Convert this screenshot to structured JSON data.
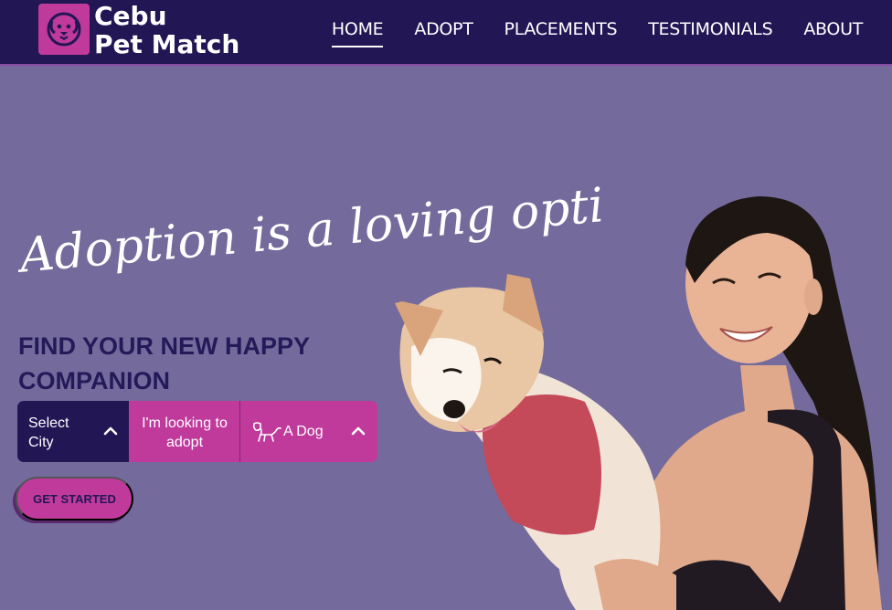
{
  "brand": {
    "line1": "Cebu",
    "line2": "Pet Match"
  },
  "nav": {
    "items": [
      {
        "label": "HOME",
        "active": true
      },
      {
        "label": "ADOPT",
        "active": false
      },
      {
        "label": "PLACEMENTS",
        "active": false
      },
      {
        "label": "TESTIMONIALS",
        "active": false
      },
      {
        "label": "ABOUT",
        "active": false
      }
    ]
  },
  "hero": {
    "script_tagline": "Adoption is a loving option",
    "headline_line1": "FIND YOUR NEW HAPPY",
    "headline_line2": "COMPANION"
  },
  "search": {
    "city_line1": "Select",
    "city_line2": "City",
    "looking_line1": "I'm looking to",
    "looking_line2": "adopt",
    "pet_value": "A Dog",
    "pet_icon": "dog-outline-icon",
    "chevron_icon": "chevron-up-icon"
  },
  "cta": {
    "label": "GET STARTED"
  },
  "colors": {
    "nav_bg": "#221655",
    "page_bg": "#746b9c",
    "accent": "#c03a9c",
    "headline": "#241a5a"
  }
}
